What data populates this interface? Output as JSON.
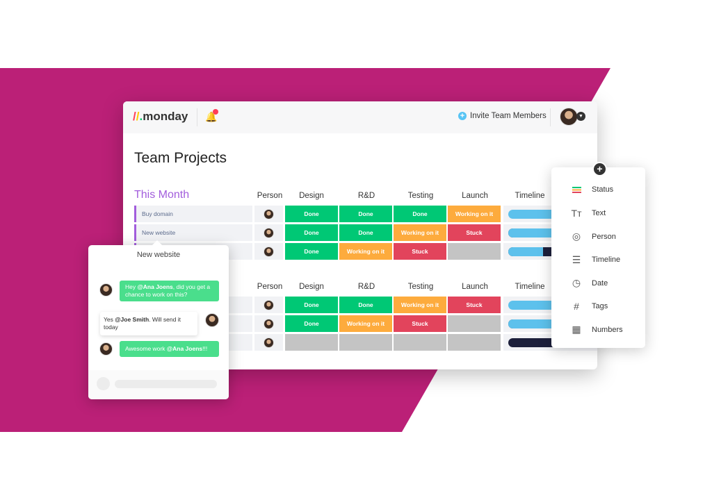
{
  "colors": {
    "background_shape": "#bb2077",
    "done": "#00c875",
    "working": "#fdab3d",
    "stuck": "#e2445c",
    "empty": "#c4c4c4",
    "timeline_blue": "#5dc1ec",
    "timeline_dark": "#1c1f3b",
    "group": "#a25ddc"
  },
  "header": {
    "logo": "monday",
    "invite_label": "Invite Team Members"
  },
  "board": {
    "title": "Team Projects",
    "columns": [
      "Person",
      "Design",
      "R&D",
      "Testing",
      "Launch",
      "Timeline"
    ],
    "groups": [
      {
        "title": "This Month",
        "rows": [
          {
            "name": "Buy domain",
            "status": [
              "Done",
              "Done",
              "Done",
              "Working on it"
            ],
            "timeline": 1.0
          },
          {
            "name": "New website",
            "status": [
              "Done",
              "Done",
              "Working on it",
              "Stuck"
            ],
            "timeline": 0.85
          },
          {
            "name": "",
            "status": [
              "Done",
              "Working on it",
              "Stuck",
              ""
            ],
            "timeline": 0.45
          }
        ]
      },
      {
        "title": "",
        "rows": [
          {
            "name": "",
            "status": [
              "Done",
              "Done",
              "Working on it",
              "Stuck"
            ],
            "timeline": 1.0
          },
          {
            "name": "",
            "status": [
              "Done",
              "Working on it",
              "Stuck",
              ""
            ],
            "timeline": 0.65
          },
          {
            "name": "",
            "status": [
              "",
              "",
              "",
              ""
            ],
            "timeline": 0.0
          }
        ]
      }
    ]
  },
  "chat": {
    "title": "New website",
    "messages": [
      {
        "pre": "Hey ",
        "mention": "@Ana Joens",
        "post": ", did you get a chance to work on this?"
      },
      {
        "pre": "Yes ",
        "mention": "@Joe Smith",
        "post": ". Will send it today"
      },
      {
        "pre": "Awesome work ",
        "mention": "@Ana Joens",
        "post": "!!!"
      }
    ]
  },
  "column_menu": {
    "items": [
      {
        "label": "Status",
        "icon": "status-icon"
      },
      {
        "label": "Text",
        "icon": "text-icon"
      },
      {
        "label": "Person",
        "icon": "person-icon"
      },
      {
        "label": "Timeline",
        "icon": "timeline-icon"
      },
      {
        "label": "Date",
        "icon": "date-icon"
      },
      {
        "label": "Tags",
        "icon": "tags-icon"
      },
      {
        "label": "Numbers",
        "icon": "numbers-icon"
      }
    ]
  }
}
